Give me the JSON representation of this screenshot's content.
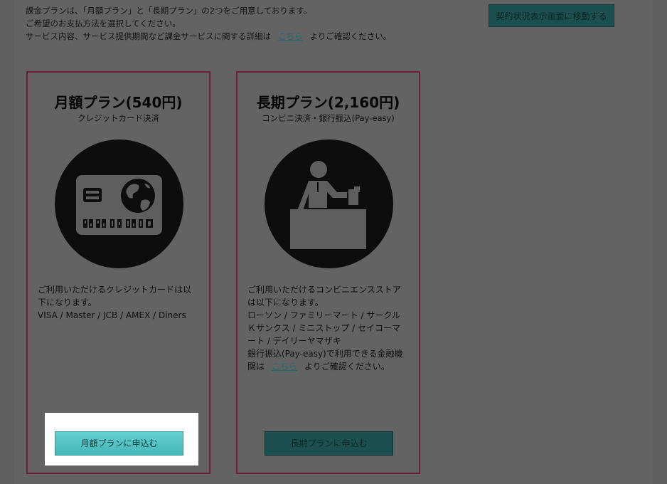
{
  "intro": {
    "line1": "課金プランは、「月額プラン」と「長期プラン」の2つをご用意しております。",
    "line2": "ご希望のお支払方法を選択してください。",
    "line3_prefix": "サービス内容、サービス提供期間など課金サービスに関する詳細は",
    "line3_link": "こちら",
    "line3_suffix": "よりご確認ください。"
  },
  "top_button": {
    "label": "契約状況表示画面に移動する"
  },
  "plans": [
    {
      "title": "月額プラン(540円)",
      "subtitle": "クレジットカード決済",
      "icon": "credit-card-icon",
      "desc_line1": "ご利用いただけるクレジットカードは以下になります。",
      "desc_line2": "VISA / Master / JCB / AMEX / Diners",
      "button_label": "月額プランに申込む"
    },
    {
      "title": "長期プラン(2,160円)",
      "subtitle": "コンビニ決済・銀行振込(Pay-easy)",
      "icon": "cashier-counter-icon",
      "desc_line1": "ご利用いただけるコンビニエンスストアは以下になります。",
      "desc_line2": "ローソン / ファミリーマート / サークルＫサンクス / ミニストップ / セイコーマート / デイリーヤマザキ",
      "desc_line3_prefix": "銀行振込(Pay-easy)で利用できる金融機関は",
      "desc_line3_link": "こちら",
      "desc_line3_suffix": "よりご確認ください。",
      "button_label": "長期プランに申込む"
    }
  ],
  "colors": {
    "overlay_bg": "#636363",
    "card_border": "#6d1f3a",
    "button_active": "#4fc0c0",
    "button_dim": "#1c4f4f",
    "link": "#1f6c6c"
  }
}
